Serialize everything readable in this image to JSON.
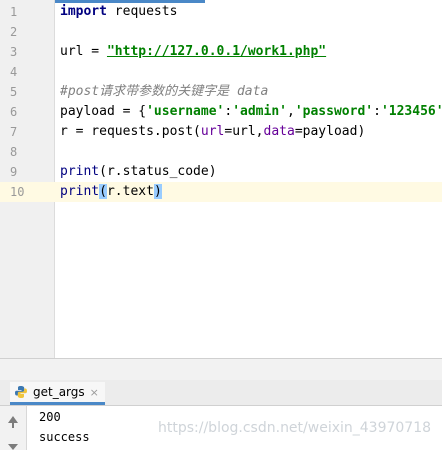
{
  "editor": {
    "line_numbers": [
      "1",
      "2",
      "3",
      "4",
      "5",
      "6",
      "7",
      "8",
      "9",
      "10"
    ],
    "code": {
      "l1_kw": "import",
      "l1_rest": " requests",
      "l3_pre": "url = ",
      "l3_url": "\"http://127.0.0.1/work1.php\"",
      "l5_comment": "#post请求带参数的关键字是 data",
      "l6_pre": "payload = {",
      "l6_k1": "'username'",
      "l6_c1": ":",
      "l6_v1": "'admin'",
      "l6_comma": ",",
      "l6_k2": "'password'",
      "l6_c2": ":",
      "l6_v2": "'123456'",
      "l6_end": "}",
      "l7_pre": "r = requests.post(",
      "l7_kw1": "url",
      "l7_mid": "=url,",
      "l7_kw2": "data",
      "l7_end": "=payload)",
      "l9_fn": "print",
      "l9_rest": "(r.status_code)",
      "l10_fn": "print",
      "l10_open": "(",
      "l10_mid": "r.text",
      "l10_close": ")"
    },
    "current_line": "10"
  },
  "run_panel": {
    "tab_label": "get_args",
    "tab_close": "×",
    "icon": "python-icon",
    "output": [
      "200",
      "success"
    ]
  },
  "watermark": "https://blog.csdn.net/weixin_43970718",
  "colors": {
    "keyword": "#000080",
    "string": "#008000",
    "comment": "#808080",
    "kwarg": "#660099",
    "current_line_bg": "#fffae3",
    "brace_highlight": "#99ccff"
  }
}
